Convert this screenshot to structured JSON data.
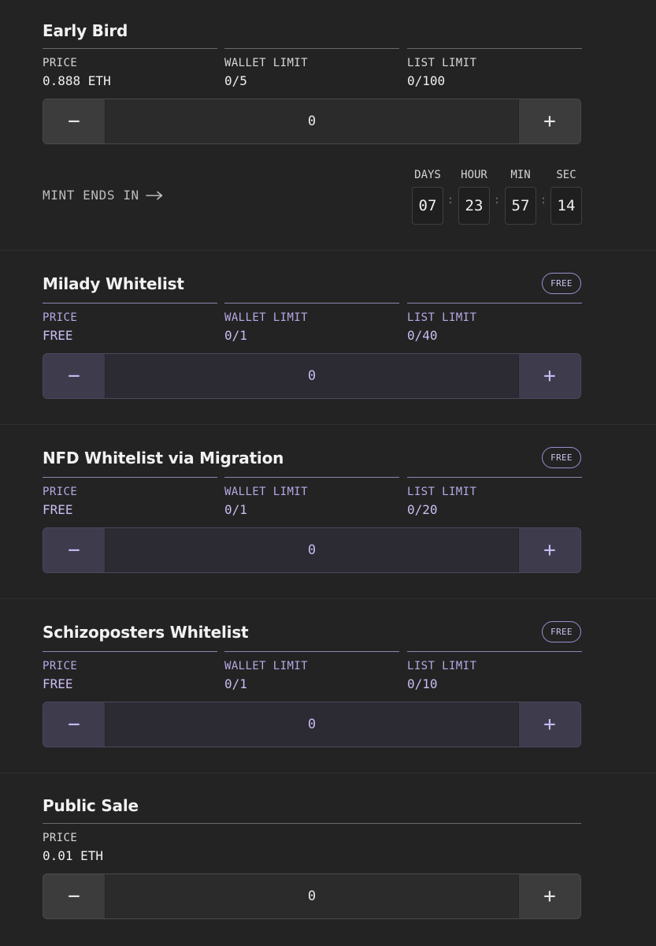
{
  "sections": [
    {
      "title": "Early Bird",
      "price_label": "PRICE",
      "price_value": "0.888 ETH",
      "wallet_label": "WALLET LIMIT",
      "wallet_value": "0/5",
      "list_label": "LIST LIMIT",
      "list_value": "0/100",
      "quantity": "0"
    },
    {
      "title": "Milady Whitelist",
      "badge": "FREE",
      "price_label": "PRICE",
      "price_value": "FREE",
      "wallet_label": "WALLET LIMIT",
      "wallet_value": "0/1",
      "list_label": "LIST LIMIT",
      "list_value": "0/40",
      "quantity": "0"
    },
    {
      "title": "NFD Whitelist via Migration",
      "badge": "FREE",
      "price_label": "PRICE",
      "price_value": "FREE",
      "wallet_label": "WALLET LIMIT",
      "wallet_value": "0/1",
      "list_label": "LIST LIMIT",
      "list_value": "0/20",
      "quantity": "0"
    },
    {
      "title": "Schizoposters Whitelist",
      "badge": "FREE",
      "price_label": "PRICE",
      "price_value": "FREE",
      "wallet_label": "WALLET LIMIT",
      "wallet_value": "0/1",
      "list_label": "LIST LIMIT",
      "list_value": "0/10",
      "quantity": "0"
    },
    {
      "title": "Public Sale",
      "price_label": "PRICE",
      "price_value": "0.01 ETH",
      "quantity": "0"
    }
  ],
  "stepper": {
    "minus": "−",
    "plus": "+"
  },
  "mint_ends": {
    "label": "MINT ENDS IN",
    "days_label": "DAYS",
    "days": "07",
    "hour_label": "HOUR",
    "hour": "23",
    "min_label": "MIN",
    "min": "57",
    "sec_label": "SEC",
    "sec": "14",
    "separator": ":"
  },
  "colors": {
    "background": "#232323",
    "accent_purple": "#cbbcf2",
    "badge_border": "#9b8fd0"
  }
}
